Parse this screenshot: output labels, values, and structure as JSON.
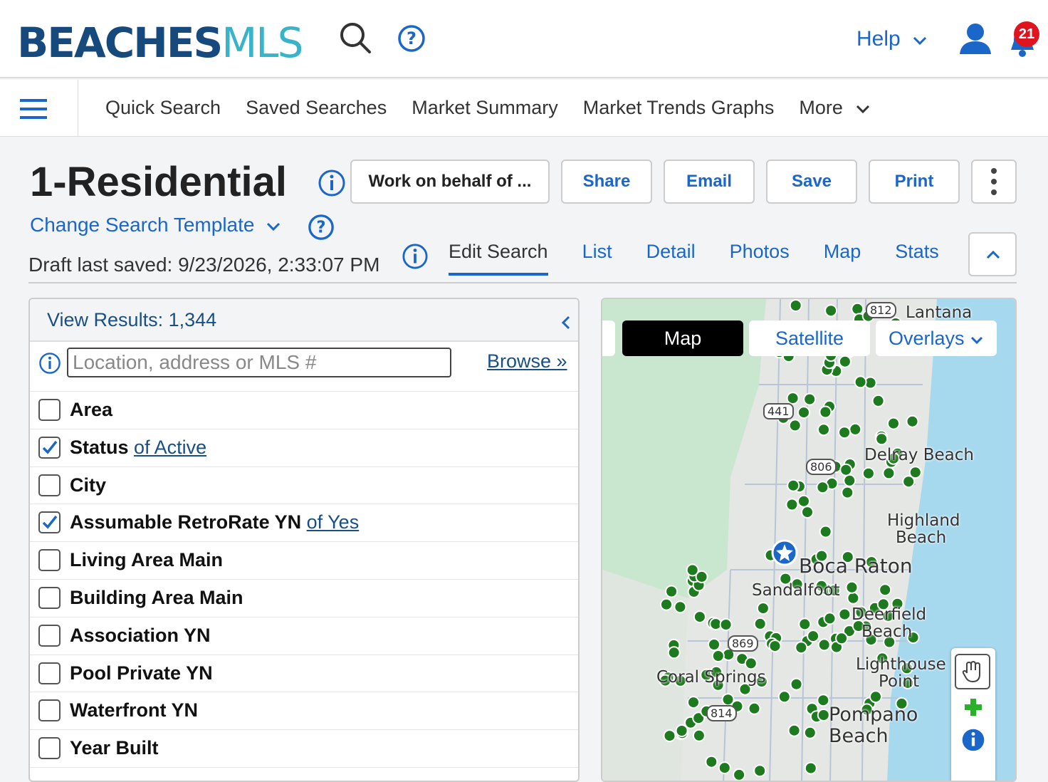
{
  "header": {
    "logo_bold": "BEACHES",
    "logo_light": "MLS",
    "help_label": "Help",
    "notification_count": "21"
  },
  "nav": {
    "items": [
      "Quick Search",
      "Saved Searches",
      "Market Summary",
      "Market Trends Graphs",
      "More"
    ]
  },
  "page": {
    "title": "1-Residential",
    "change_template": "Change Search Template",
    "draft_saved": "Draft last saved: 9/23/2026, 2:33:07 PM"
  },
  "actions": {
    "work_on_behalf": "Work on behalf of ...",
    "share": "Share",
    "email": "Email",
    "save": "Save",
    "print": "Print"
  },
  "tabs": [
    "Edit Search",
    "List",
    "Detail",
    "Photos",
    "Map",
    "Stats"
  ],
  "panel": {
    "view_results": "View Results: 1,344",
    "search_placeholder": "Location, address or MLS #",
    "browse": "Browse »",
    "criteria": [
      {
        "label": "Area",
        "checked": false,
        "link": ""
      },
      {
        "label": "Status",
        "checked": true,
        "link": "of Active"
      },
      {
        "label": "City",
        "checked": false,
        "link": ""
      },
      {
        "label": "Assumable RetroRate YN",
        "checked": true,
        "link": "of Yes"
      },
      {
        "label": "Living Area Main",
        "checked": false,
        "link": ""
      },
      {
        "label": "Building Area Main",
        "checked": false,
        "link": ""
      },
      {
        "label": "Association YN",
        "checked": false,
        "link": ""
      },
      {
        "label": "Pool Private YN",
        "checked": false,
        "link": ""
      },
      {
        "label": "Waterfront YN",
        "checked": false,
        "link": ""
      },
      {
        "label": "Year Built",
        "checked": false,
        "link": ""
      }
    ]
  },
  "map": {
    "map_btn": "Map",
    "satellite_btn": "Satellite",
    "overlays_btn": "Overlays",
    "labels": {
      "lantana": "Lantana",
      "delray": "Delray Beach",
      "highland": "Highland",
      "highland2": "Beach",
      "boca": "Boca Raton",
      "sandalfoot": "Sandalfoot",
      "deerfield": "Deerfield",
      "deerfield2": "Beach",
      "lighthouse": "Lighthouse",
      "lighthouse2": "Point",
      "coral": "Coral Springs",
      "pompano": "Pompano",
      "pompano2": "Beach",
      "r441": "441",
      "r869": "869",
      "r814": "814",
      "r812": "812",
      "r806": "806"
    }
  },
  "colors": {
    "brand_blue": "#1a66c9",
    "logo_navy": "#174a7c",
    "logo_teal": "#39b3c8",
    "listing_dot": "#1e7a1e",
    "badge_red": "#e0141e"
  }
}
